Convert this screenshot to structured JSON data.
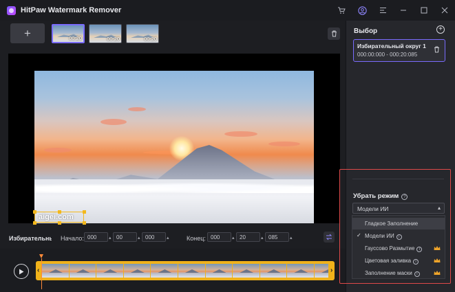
{
  "app": {
    "title": "HitPaw Watermark Remover"
  },
  "titlebar": {
    "icons": [
      "cart-icon",
      "account-icon",
      "menu-icon",
      "minimize-icon",
      "maximize-icon",
      "close-icon"
    ]
  },
  "media": {
    "add_label": "+",
    "thumbnails": [
      {
        "duration": "00:20",
        "active": true
      },
      {
        "duration": "00:20",
        "active": false
      },
      {
        "duration": "00:20",
        "active": false
      }
    ]
  },
  "preview": {
    "watermark_text": "aigei.com"
  },
  "controls": {
    "selection_label": "Избирательны...",
    "start_label": "Начало:",
    "start": [
      "000",
      "00",
      "000"
    ],
    "end_label": "Конец:",
    "end": [
      "000",
      "20",
      "085"
    ]
  },
  "right_panel": {
    "title": "Выбор",
    "add_label": "+",
    "region": {
      "name": "Избирательный округ 1",
      "time": "000:00:000 - 000:20:085"
    },
    "mode": {
      "label": "Убрать режим",
      "selected": "Модели ИИ",
      "options": [
        {
          "label": "Гладкое Заполнение",
          "help": false,
          "premium": false,
          "checked": false,
          "highlighted": true
        },
        {
          "label": "Модели ИИ",
          "help": true,
          "premium": false,
          "checked": true,
          "highlighted": false
        },
        {
          "label": "Гауссово Размытие",
          "help": true,
          "premium": true,
          "checked": false,
          "highlighted": false
        },
        {
          "label": "Цветовая заливка",
          "help": true,
          "premium": true,
          "checked": false,
          "highlighted": false
        },
        {
          "label": "Заполнение маски",
          "help": true,
          "premium": true,
          "checked": false,
          "highlighted": false
        }
      ]
    }
  },
  "colors": {
    "accent": "#7a6cff",
    "timeline": "#f0b21a",
    "playhead": "#ff8a3a",
    "highlight_border": "#e04a4a"
  }
}
